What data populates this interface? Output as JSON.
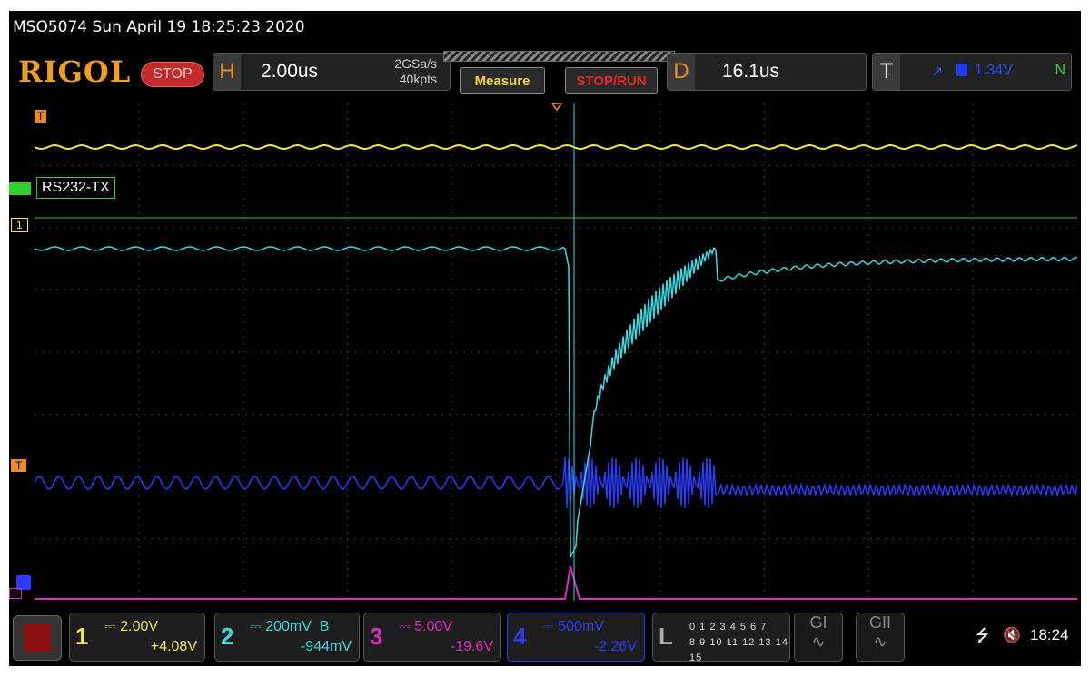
{
  "header": {
    "device_line": "MSO5074  Sun April 19 18:25:23 2020",
    "brand": "RIGOL",
    "run_state": "STOP"
  },
  "horizontal": {
    "tag": "H",
    "timebase": "2.00us",
    "sample_rate": "2GSa/s",
    "memory_depth": "40kpts"
  },
  "toolbar": {
    "measure_label": "Measure",
    "stoprun_label": "STOP/RUN"
  },
  "delay": {
    "tag": "D",
    "value": "16.1us"
  },
  "trigger": {
    "tag": "T",
    "edge_icon": "rising-edge-icon",
    "level": "1.34V",
    "mode": "N"
  },
  "labels": {
    "rs232": "RS232-TX",
    "ch1_marker": "1",
    "trig_marker": "T"
  },
  "channels": [
    {
      "num": "1",
      "scale": "2.00V",
      "coupling": "",
      "offset": "+4.08V",
      "color": "#f5e642"
    },
    {
      "num": "2",
      "scale": "200mV",
      "coupling": "B",
      "offset": "-944mV",
      "color": "#3fd6e0"
    },
    {
      "num": "3",
      "scale": "5.00V",
      "coupling": "",
      "offset": "-19.6V",
      "color": "#e02ac0"
    },
    {
      "num": "4",
      "scale": "500mV",
      "coupling": "",
      "offset": "-2.26V",
      "color": "#2a3cf5"
    }
  ],
  "logic": {
    "tag": "L",
    "row1": "0 1 2 3  4 5 6 7",
    "row2": "8 9 10 11 12 13 14 15"
  },
  "decoders": [
    "GI",
    "GII"
  ],
  "status": {
    "clock": "18:24"
  },
  "colors": {
    "ch1": "#f5e642",
    "ch2": "#3fd6e0",
    "ch3": "#e02ac0",
    "ch4": "#2a3cf5",
    "digital": "#2fd02f",
    "accent": "#f08a20"
  }
}
